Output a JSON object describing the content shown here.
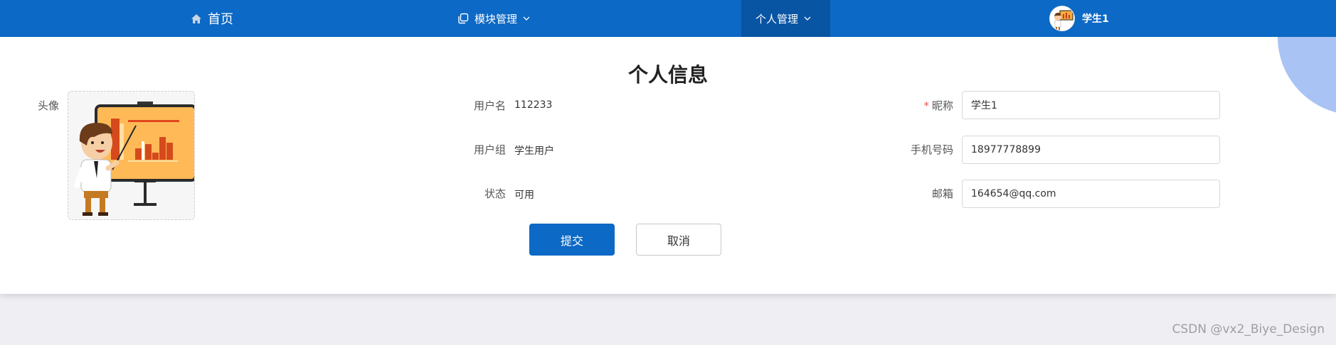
{
  "nav": {
    "home_label": "首页",
    "modules_label": "模块管理",
    "personal_label": "个人管理",
    "user_name": "学生1",
    "bar_color": "#0c69c5",
    "active_color": "#0855a3"
  },
  "page": {
    "title": "个人信息"
  },
  "profile": {
    "avatar_label": "头像",
    "username_label": "用户名",
    "username_value": "112233",
    "group_label": "用户组",
    "group_value": "学生用户",
    "status_label": "状态",
    "status_value": "可用",
    "nickname_label": "昵称",
    "nickname_required": "*",
    "nickname_value": "学生1",
    "phone_label": "手机号码",
    "phone_value": "18977778899",
    "email_label": "邮箱",
    "email_value": "164654@qq.com"
  },
  "actions": {
    "submit_label": "提交",
    "cancel_label": "取消"
  },
  "watermark": "CSDN @vx2_Biye_Design",
  "icons": {
    "home": "home-icon",
    "modules": "copy-icon",
    "dropdown": "chevron-down-icon",
    "avatar": "teacher-presentation-illustration"
  }
}
